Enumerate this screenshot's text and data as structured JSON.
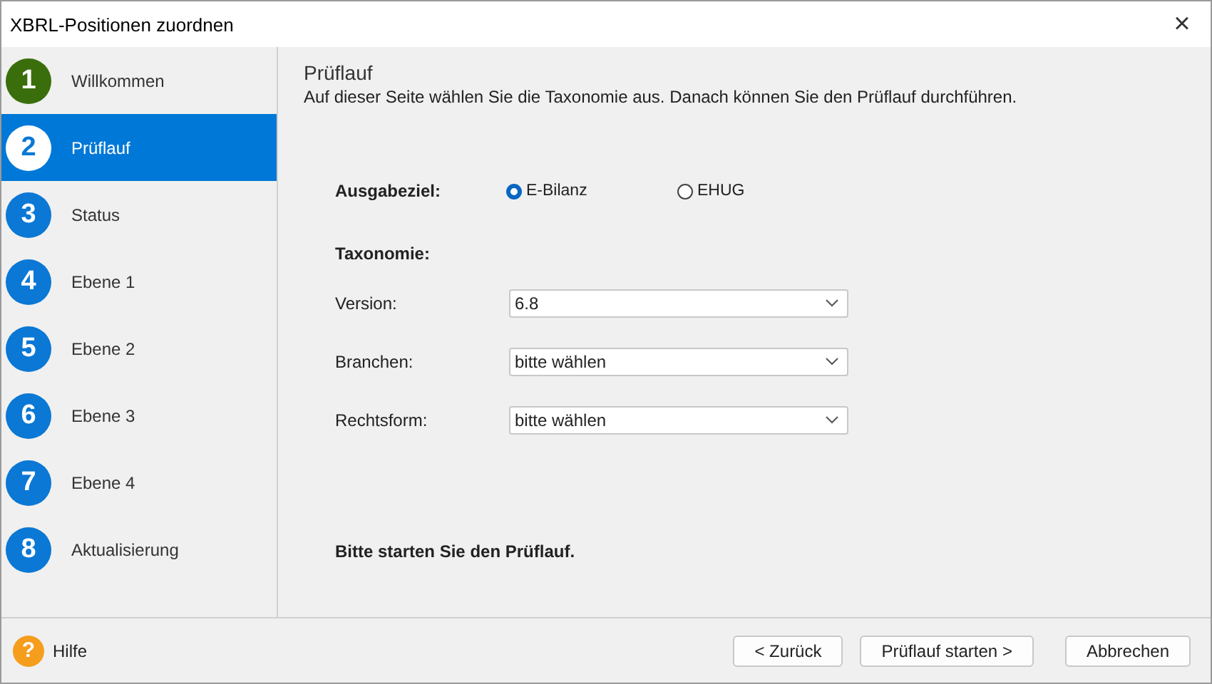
{
  "window": {
    "title": "XBRL-Positionen zuordnen",
    "close": "×"
  },
  "steps": [
    {
      "number": "1",
      "label": "Willkommen",
      "done": true,
      "selected": false
    },
    {
      "number": "2",
      "label": "Prüflauf",
      "done": false,
      "selected": true
    },
    {
      "number": "3",
      "label": "Status",
      "done": false,
      "selected": false
    },
    {
      "number": "4",
      "label": "Ebene 1",
      "done": false,
      "selected": false
    },
    {
      "number": "5",
      "label": "Ebene 2",
      "done": false,
      "selected": false
    },
    {
      "number": "6",
      "label": "Ebene 3",
      "done": false,
      "selected": false
    },
    {
      "number": "7",
      "label": "Ebene 4",
      "done": false,
      "selected": false
    },
    {
      "number": "8",
      "label": "Aktualisierung",
      "done": false,
      "selected": false
    }
  ],
  "page": {
    "title": "Prüflauf",
    "description": "Auf dieser Seite wählen Sie die Taxonomie aus. Danach können Sie den Prüflauf durchführen."
  },
  "output": {
    "label": "Ausgabeziel:",
    "options": [
      {
        "label": "E-Bilanz",
        "selected": true
      },
      {
        "label": "EHUG",
        "selected": false
      }
    ]
  },
  "taxonomy": {
    "heading": "Taxonomie:",
    "fields": [
      {
        "label": "Version:",
        "value": "6.8"
      },
      {
        "label": "Branchen:",
        "value": "bitte wählen"
      },
      {
        "label": "Rechtsform:",
        "value": "bitte wählen"
      }
    ]
  },
  "message": "Bitte starten Sie den Prüflauf.",
  "footer": {
    "help_icon": "?",
    "help": "Hilfe",
    "buttons": [
      "< Zurück",
      "Prüflauf starten >",
      "Abbrechen"
    ]
  }
}
